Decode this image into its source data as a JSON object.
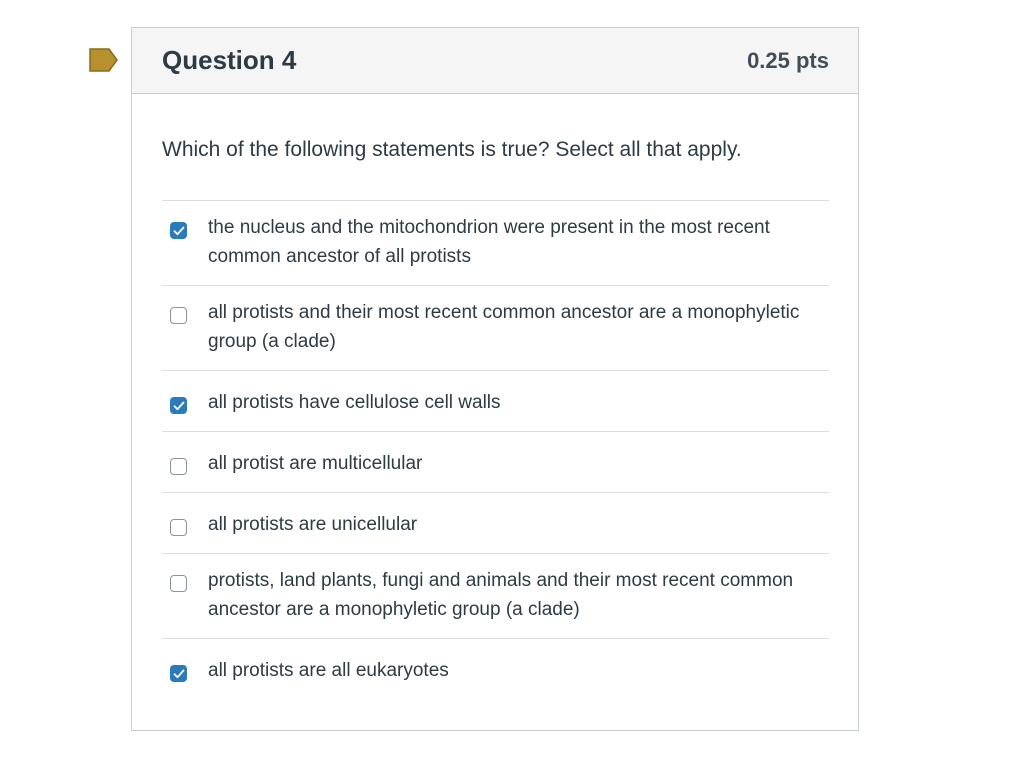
{
  "question": {
    "title": "Question 4",
    "points": "0.25 pts",
    "text": "Which of the following statements is true?  Select all that apply.",
    "flag_icon": "bookmark-flag-icon",
    "flag_color": "#b8912f",
    "answers": [
      {
        "label": "the nucleus and the mitochondrion were present in the most recent common ancestor of all protists",
        "checked": true
      },
      {
        "label": "all protists and their most recent common ancestor are a monophyletic group (a clade)",
        "checked": false
      },
      {
        "label": "all protists have cellulose cell walls",
        "checked": true
      },
      {
        "label": "all protist are multicellular",
        "checked": false
      },
      {
        "label": "all protists are unicellular",
        "checked": false
      },
      {
        "label": "protists, land plants, fungi and animals and their most recent common ancestor are a monophyletic group (a clade)",
        "checked": false
      },
      {
        "label": "all protists are all eukaryotes",
        "checked": true
      }
    ]
  }
}
